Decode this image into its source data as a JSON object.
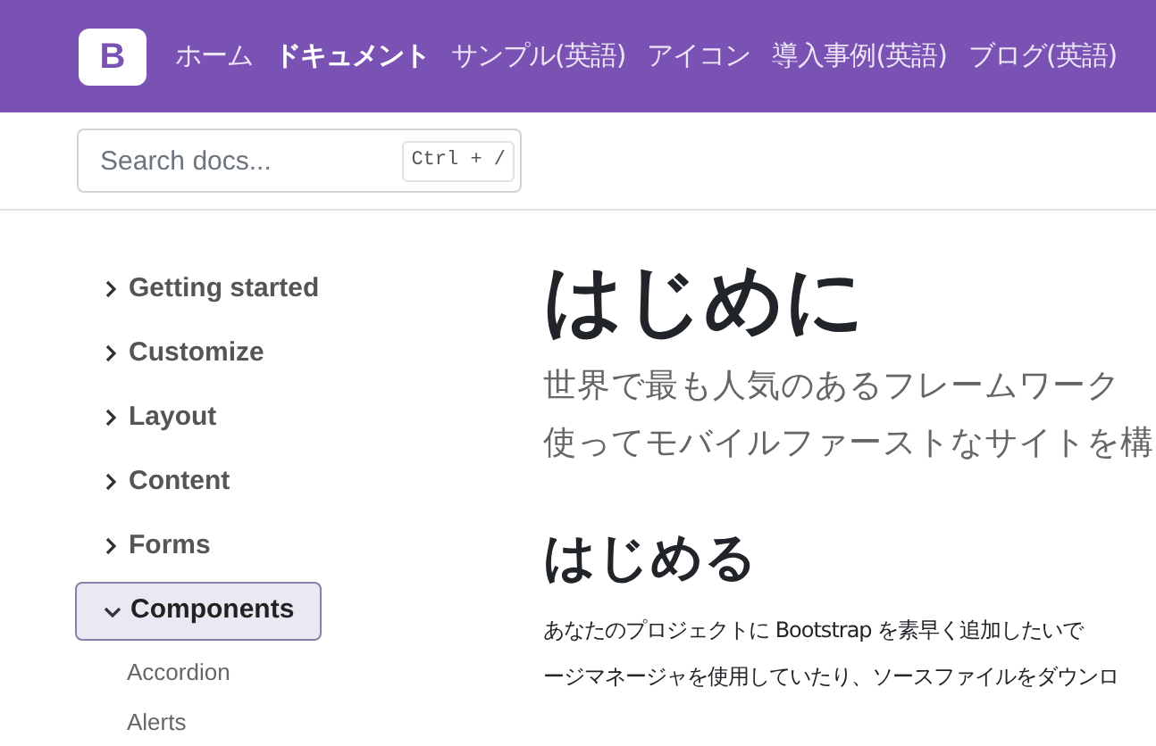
{
  "header": {
    "logo": "B",
    "nav": [
      {
        "label": "ホーム",
        "selected": false
      },
      {
        "label": "ドキュメント",
        "selected": true
      },
      {
        "label": "サンプル(英語)",
        "selected": false
      },
      {
        "label": "アイコン",
        "selected": false
      },
      {
        "label": "導入事例(英語)",
        "selected": false
      },
      {
        "label": "ブログ(英語)",
        "selected": false
      }
    ]
  },
  "search": {
    "placeholder": "Search docs...",
    "shortcut": "Ctrl + /"
  },
  "sidebar": {
    "items": [
      {
        "label": "Getting started",
        "expanded": false
      },
      {
        "label": "Customize",
        "expanded": false
      },
      {
        "label": "Layout",
        "expanded": false
      },
      {
        "label": "Content",
        "expanded": false
      },
      {
        "label": "Forms",
        "expanded": false
      },
      {
        "label": "Components",
        "expanded": true,
        "children": [
          {
            "label": "Accordion"
          },
          {
            "label": "Alerts"
          }
        ]
      }
    ]
  },
  "content": {
    "title": "はじめに",
    "lead": [
      "世界で最も人気のあるフレームワーク",
      "使ってモバイルファーストなサイトを構"
    ],
    "heading": "はじめる",
    "paragraph": [
      "あなたのプロジェクトに Bootstrap を素早く追加したいで",
      "ージマネージャを使用していたり、ソースファイルをダウンロ"
    ]
  }
}
